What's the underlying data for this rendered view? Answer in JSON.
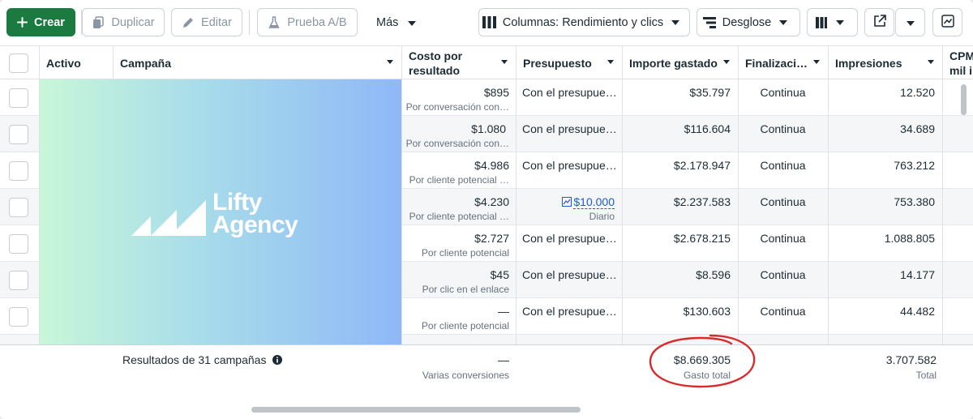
{
  "toolbar": {
    "create_label": "Crear",
    "duplicate_label": "Duplicar",
    "edit_label": "Editar",
    "abtest_label": "Prueba A/B",
    "more_label": "Más",
    "columns_label": "Columnas: Rendimiento y clics",
    "breakdown_label": "Desglose"
  },
  "columns": {
    "active": "Activo",
    "campaign": "Campaña",
    "cost_line1": "Costo por",
    "cost_line2": "resultado",
    "budget": "Presupuesto",
    "spent": "Importe gastado",
    "end": "Finalizaci…",
    "impressions": "Impresiones",
    "cpm_line1": "CPM",
    "cpm_line2": "mil i"
  },
  "banner": {
    "logo_line1": "Lifty",
    "logo_line2": "Agency"
  },
  "rows": [
    {
      "cost": "$895",
      "cost_sub": "Por conversación con…",
      "budget": "Con el presupue…",
      "spent": "$35.797",
      "end": "Continua",
      "impressions": "12.520"
    },
    {
      "cost": "$1.080",
      "cost_sub": "Por conversación con…",
      "budget": "Con el presupue…",
      "spent": "$116.604",
      "end": "Continua",
      "impressions": "34.689"
    },
    {
      "cost": "$4.986",
      "cost_sub": "Por cliente potencial …",
      "budget": "Con el presupue…",
      "spent": "$2.178.947",
      "end": "Continua",
      "impressions": "763.212"
    },
    {
      "cost": "$4.230",
      "cost_sub": "Por cliente potencial …",
      "budget": "$10.000",
      "budget_sub": "Diario",
      "spent": "$2.237.583",
      "end": "Continua",
      "impressions": "753.380"
    },
    {
      "cost": "$2.727",
      "cost_sub": "Por cliente potencial",
      "budget": "Con el presupue…",
      "spent": "$2.678.215",
      "end": "Continua",
      "impressions": "1.088.805"
    },
    {
      "cost": "$45",
      "cost_sub": "Por clic en el enlace",
      "budget": "Con el presupue…",
      "spent": "$8.596",
      "end": "Continua",
      "impressions": "14.177"
    },
    {
      "cost": "—",
      "cost_sub": "Por cliente potencial",
      "budget": "Con el presupue…",
      "spent": "$130.603",
      "end": "Continua",
      "impressions": "44.482"
    }
  ],
  "totals": {
    "label": "Resultados de 31 campañas",
    "cost": "—",
    "cost_sub": "Varias conversiones",
    "spent": "$8.669.305",
    "spent_sub": "Gasto total",
    "impressions": "3.707.582",
    "impressions_sub": "Total"
  },
  "colors": {
    "primary": "#1b7a3f",
    "link": "#1c5bd6",
    "highlight": "#d92b2b"
  }
}
